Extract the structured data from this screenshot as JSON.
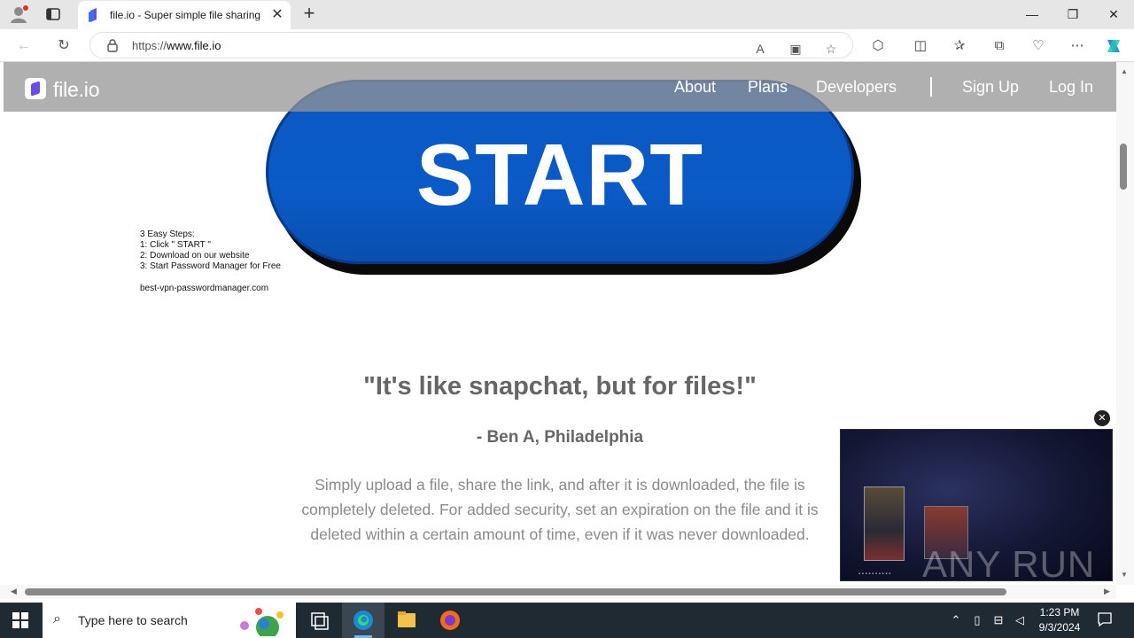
{
  "browser": {
    "tab_title": "file.io - Super simple file sharing",
    "url_prefix": "https://",
    "url_host": "www.file.io"
  },
  "site": {
    "logo_text": "file.io",
    "nav": {
      "about": "About",
      "plans": "Plans",
      "developers": "Developers",
      "signup": "Sign Up",
      "login": "Log In"
    }
  },
  "ad": {
    "button_text": "START",
    "steps": [
      "3 Easy Steps:",
      "1: Click \" START \"",
      "2: Download on our website",
      "3: Start Password Manager for Free"
    ],
    "site": "best-vpn-passwordmanager.com"
  },
  "content": {
    "quote": "\"It's like snapchat, but for files!\"",
    "author": "- Ben A, Philadelphia",
    "description": "Simply upload a file, share the link, and after it is downloaded, the file is completely deleted. For added security, set an expiration on the file and it is deleted within a certain amount of time, even if it was never downloaded."
  },
  "video": {
    "watermark": "ANY RUN"
  },
  "taskbar": {
    "search_placeholder": "Type here to search",
    "time": "1:23 PM",
    "date": "9/3/2024"
  },
  "colors": {
    "ad_blue": "#0a5ac7",
    "header_overlay": "#969696",
    "logo_purple": "#6b4ce6"
  }
}
